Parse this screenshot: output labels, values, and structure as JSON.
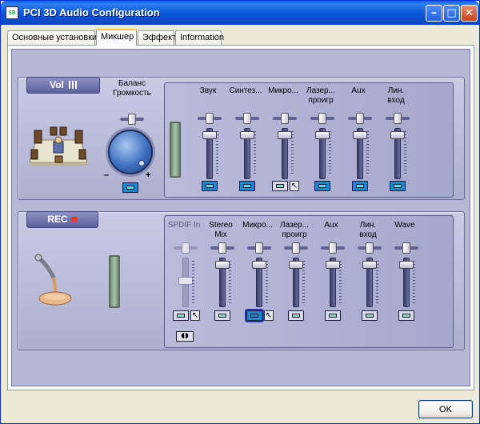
{
  "window": {
    "title": "PCI 3D Audio Configuration",
    "icon_text": "SB"
  },
  "titlebar_buttons": {
    "minimize": "–",
    "maximize": "□",
    "close": "✕"
  },
  "tabs": [
    {
      "label": "Основные установки",
      "active": false
    },
    {
      "label": "Микшер",
      "active": true
    },
    {
      "label": "Эффект",
      "active": false
    },
    {
      "label": "Information",
      "active": false
    }
  ],
  "playback": {
    "title": "Vol",
    "balance_label_1": "Баланс",
    "balance_label_2": "Громкость",
    "minus": "–",
    "plus": "+",
    "channels": [
      {
        "label_1": "Звук",
        "label_2": "",
        "level": 0.95,
        "mute": "on",
        "advanced": false
      },
      {
        "label_1": "Синтез...",
        "label_2": "",
        "level": 0.95,
        "mute": "on",
        "advanced": false
      },
      {
        "label_1": "Микро...",
        "label_2": "",
        "level": 0.95,
        "mute": "off",
        "advanced": true
      },
      {
        "label_1": "Лазер...",
        "label_2": "проигр",
        "level": 0.95,
        "mute": "on",
        "advanced": false
      },
      {
        "label_1": "Aux",
        "label_2": "",
        "level": 0.95,
        "mute": "on",
        "advanced": false
      },
      {
        "label_1": "Лин.",
        "label_2": "вход",
        "level": 0.95,
        "mute": "on",
        "advanced": false
      }
    ]
  },
  "recording": {
    "title": "REC",
    "channels": [
      {
        "label_1": "SPDIF In",
        "label_2": "",
        "level": 0.55,
        "mute": "off",
        "advanced": true,
        "disabled": true
      },
      {
        "label_1": "Stereo",
        "label_2": "Mix",
        "level": 0.95,
        "mute": "off",
        "advanced": false,
        "disabled": false
      },
      {
        "label_1": "Микро...",
        "label_2": "",
        "level": 0.95,
        "mute": "sel",
        "advanced": true,
        "disabled": false
      },
      {
        "label_1": "Лазер...",
        "label_2": "проигр",
        "level": 0.95,
        "mute": "off",
        "advanced": false,
        "disabled": false
      },
      {
        "label_1": "Aux",
        "label_2": "",
        "level": 0.95,
        "mute": "off",
        "advanced": false,
        "disabled": false
      },
      {
        "label_1": "Лин.",
        "label_2": "вход",
        "level": 0.95,
        "mute": "off",
        "advanced": false,
        "disabled": false
      },
      {
        "label_1": "Wave",
        "label_2": "",
        "level": 0.95,
        "mute": "off",
        "advanced": false,
        "disabled": false
      }
    ],
    "spdif_button": "◖◗"
  },
  "footer": {
    "ok_label": "OK"
  }
}
